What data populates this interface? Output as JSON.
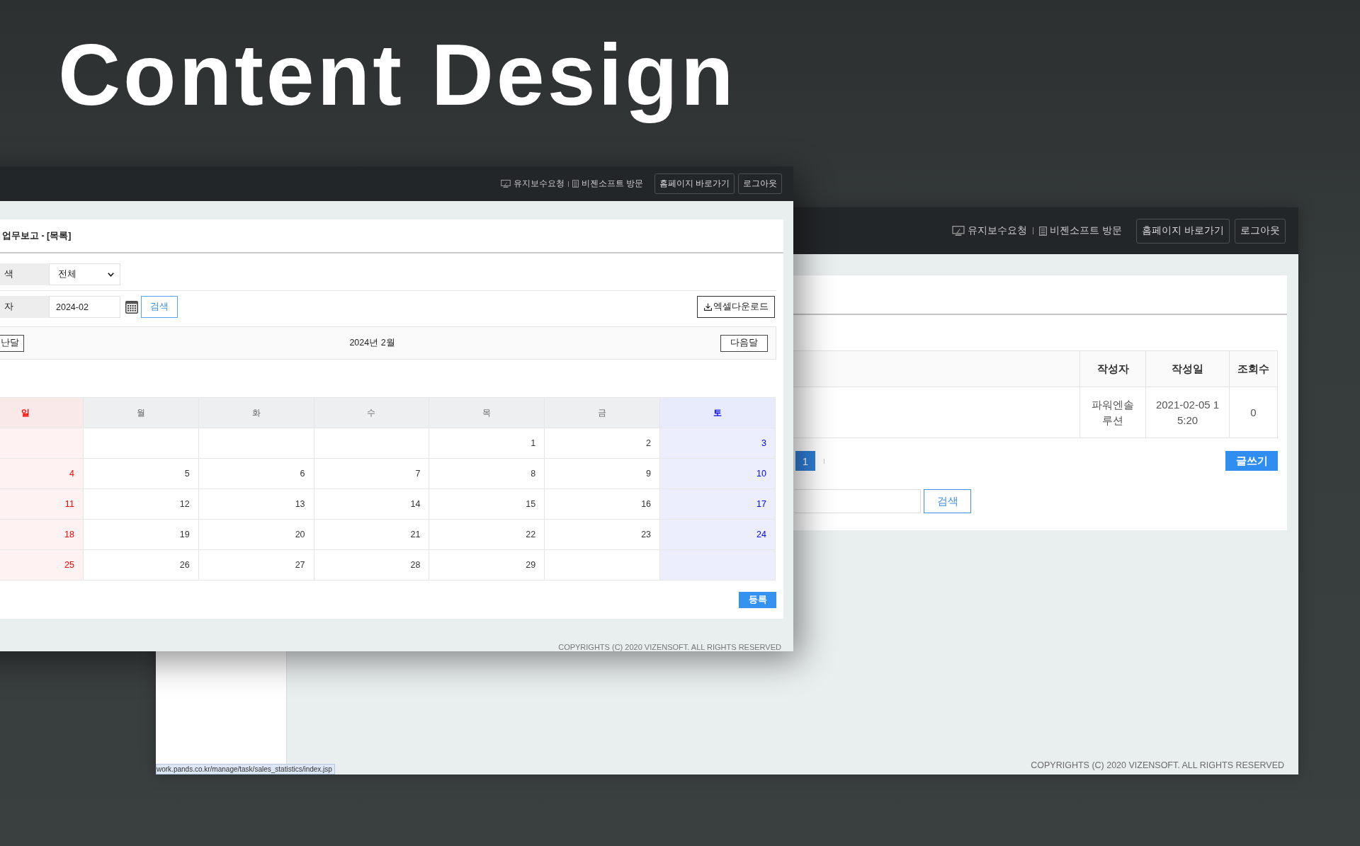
{
  "heading": "Content Design",
  "back_window": {
    "top_bar": {
      "links": [
        "유지보수요청",
        "비젠소프트 방문"
      ],
      "buttons": [
        "홈페이지 바로가기",
        "로그아웃"
      ]
    },
    "table": {
      "columns": [
        "작성자",
        "작성일",
        "조회수"
      ],
      "rows": [
        [
          "파워엔솔루션",
          "2021-02-05 15:20",
          "0"
        ]
      ]
    },
    "pagination": [
      {
        "label": "1",
        "selected": true
      }
    ],
    "write_button": "글쓰기",
    "search_button": "검색",
    "footer": "COPYRIGHTS (C) 2020 VIZENSOFT. ALL RIGHTS RESERVED",
    "status_url": "work.pands.co.kr/manage/task/sales_statistics/index.jsp"
  },
  "front_window": {
    "top_bar": {
      "links": [
        "유지보수요청",
        "비젠소프트 방문"
      ],
      "buttons": [
        "홈페이지 바로가기",
        "로그아웃"
      ]
    },
    "panel_title": "업무보고 - [목록]",
    "filters": [
      {
        "kind": "select",
        "label": "색",
        "value": "전체"
      },
      {
        "kind": "date",
        "label": "자",
        "value": "2024-02"
      }
    ],
    "search_button": "검색",
    "excel_button": "엑셀다운로드",
    "month_nav": {
      "prev": "난달",
      "title": "2024년 2월",
      "next": "다음달"
    },
    "calendar": {
      "weekdays": [
        {
          "label": "일",
          "kind": "sunday"
        },
        {
          "label": "월",
          "kind": "weekday"
        },
        {
          "label": "화",
          "kind": "weekday"
        },
        {
          "label": "수",
          "kind": "weekday"
        },
        {
          "label": "목",
          "kind": "weekday"
        },
        {
          "label": "금",
          "kind": "weekday"
        },
        {
          "label": "토",
          "kind": "saturday"
        }
      ],
      "weeks": [
        [
          {
            "kind": "blank"
          },
          {
            "kind": "blank"
          },
          {
            "kind": "blank"
          },
          {
            "kind": "blank"
          },
          {
            "kind": "day",
            "label": "1"
          },
          {
            "kind": "day",
            "label": "2"
          },
          {
            "kind": "day",
            "label": "3"
          }
        ],
        [
          {
            "kind": "day",
            "label": "4"
          },
          {
            "kind": "day",
            "label": "5"
          },
          {
            "kind": "day",
            "label": "6"
          },
          {
            "kind": "day",
            "label": "7"
          },
          {
            "kind": "day",
            "label": "8"
          },
          {
            "kind": "day",
            "label": "9"
          },
          {
            "kind": "day",
            "label": "10"
          }
        ],
        [
          {
            "kind": "day",
            "label": "11"
          },
          {
            "kind": "day",
            "label": "12"
          },
          {
            "kind": "day",
            "label": "13"
          },
          {
            "kind": "day",
            "label": "14"
          },
          {
            "kind": "day",
            "label": "15"
          },
          {
            "kind": "day",
            "label": "16"
          },
          {
            "kind": "day",
            "label": "17"
          }
        ],
        [
          {
            "kind": "day",
            "label": "18"
          },
          {
            "kind": "day",
            "label": "19"
          },
          {
            "kind": "day",
            "label": "20"
          },
          {
            "kind": "day",
            "label": "21"
          },
          {
            "kind": "day",
            "label": "22"
          },
          {
            "kind": "day",
            "label": "23"
          },
          {
            "kind": "day",
            "label": "24"
          }
        ],
        [
          {
            "kind": "day",
            "label": "25"
          },
          {
            "kind": "day",
            "label": "26"
          },
          {
            "kind": "day",
            "label": "27"
          },
          {
            "kind": "day",
            "label": "28"
          },
          {
            "kind": "day",
            "label": "29"
          },
          {
            "kind": "blank"
          },
          {
            "kind": "blank"
          }
        ]
      ]
    },
    "register_button": "등록",
    "footer": "COPYRIGHTS (C) 2020 VIZENSOFT. ALL RIGHTS RESERVED"
  }
}
